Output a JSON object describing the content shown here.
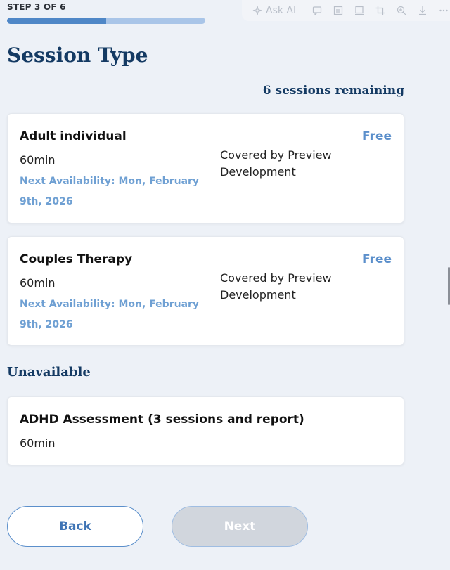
{
  "step": {
    "label": "STEP 3 OF 6",
    "progress_fraction": 0.5
  },
  "toolbar": {
    "ask_ai_label": "Ask AI",
    "icons": [
      "sparkle-icon",
      "comment-icon",
      "layout-icon",
      "note-icon",
      "crop-icon",
      "zoom-in-icon",
      "download-icon",
      "more-icon"
    ]
  },
  "page": {
    "title": "Session Type",
    "sessions_remaining": "6 sessions remaining"
  },
  "sessions": [
    {
      "name": "Adult individual",
      "duration": "60min",
      "availability": "Next Availability: Mon, February 9th, 2026",
      "coverage": "Covered by Preview Development",
      "price": "Free"
    },
    {
      "name": "Couples Therapy",
      "duration": "60min",
      "availability": "Next Availability: Mon, February 9th, 2026",
      "coverage": "Covered by Preview Development",
      "price": "Free"
    }
  ],
  "unavailable": {
    "title": "Unavailable",
    "items": [
      {
        "name": "ADHD Assessment (3 sessions and report)",
        "duration": "60min"
      }
    ]
  },
  "buttons": {
    "back": "Back",
    "next": "Next"
  },
  "colors": {
    "background": "#edf1f7",
    "heading": "#143a63",
    "accent": "#5b8fcb",
    "availability": "#6fa0d3",
    "progress_track": "#a9c5e8",
    "progress_fill": "#4f87c7"
  }
}
